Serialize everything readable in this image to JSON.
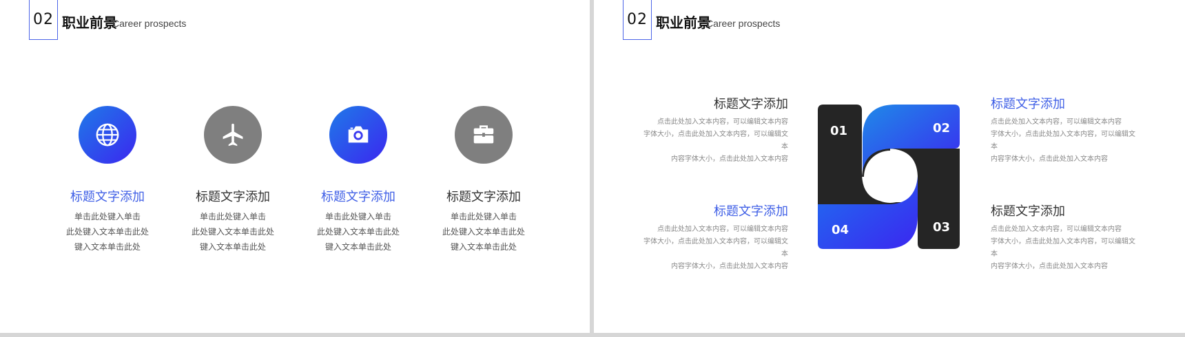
{
  "header": {
    "number": "02",
    "title": "职业前景",
    "subtitle": "Career prospects"
  },
  "left_slide": {
    "items": [
      {
        "title": "标题文字添加",
        "desc": [
          "单击此处键入单击",
          "此处键入文本单击此处",
          "键入文本单击此处"
        ],
        "icon": "globe-icon",
        "color": "blue"
      },
      {
        "title": "标题文字添加",
        "desc": [
          "单击此处键入单击",
          "此处键入文本单击此处",
          "键入文本单击此处"
        ],
        "icon": "airplane-icon",
        "color": "gray"
      },
      {
        "title": "标题文字添加",
        "desc": [
          "单击此处键入单击",
          "此处键入文本单击此处",
          "键入文本单击此处"
        ],
        "icon": "camera-icon",
        "color": "blue"
      },
      {
        "title": "标题文字添加",
        "desc": [
          "单击此处键入单击",
          "此处键入文本单击此处",
          "键入文本单击此处"
        ],
        "icon": "briefcase-icon",
        "color": "gray"
      }
    ]
  },
  "right_slide": {
    "blocks": [
      {
        "title": "标题文字添加",
        "desc": [
          "点击此处加入文本内容，可以编辑文本内容",
          "字体大小，点击此处加入文本内容，可以编辑文本",
          "内容字体大小，点击此处加入文本内容"
        ]
      },
      {
        "title": "标题文字添加",
        "desc": [
          "点击此处加入文本内容，可以编辑文本内容",
          "字体大小，点击此处加入文本内容，可以编辑文本",
          "内容字体大小，点击此处加入文本内容"
        ]
      },
      {
        "title": "标题文字添加",
        "desc": [
          "点击此处加入文本内容，可以编辑文本内容",
          "字体大小，点击此处加入文本内容，可以编辑文本",
          "内容字体大小，点击此处加入文本内容"
        ]
      },
      {
        "title": "标题文字添加",
        "desc": [
          "点击此处加入文本内容，可以编辑文本内容",
          "字体大小，点击此处加入文本内容，可以编辑文本",
          "内容字体大小，点击此处加入文本内容"
        ]
      }
    ],
    "numbers": [
      "01",
      "02",
      "03",
      "04"
    ]
  },
  "colors": {
    "accent_blue": "#3f5fe6",
    "gradient_start": "#1f7ae8",
    "gradient_end": "#3b27f0",
    "dark_shape": "#252525",
    "gray_icon": "#7f7f7f"
  }
}
